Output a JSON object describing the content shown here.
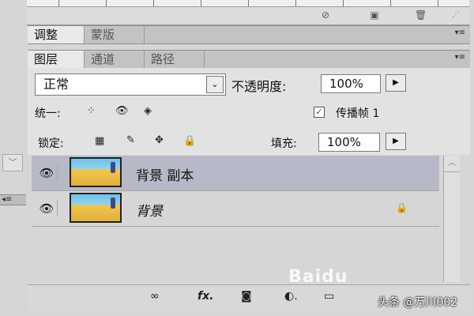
{
  "panels": {
    "adjust_group": {
      "tabs": [
        {
          "label": "调整",
          "active": true
        },
        {
          "label": "蒙版",
          "active": false
        }
      ]
    },
    "layers_group": {
      "tabs": [
        {
          "label": "图层",
          "active": true
        },
        {
          "label": "通道",
          "active": false
        },
        {
          "label": "路径",
          "active": false
        }
      ]
    }
  },
  "layers_panel": {
    "blend_mode": "正常",
    "opacity_label": "不透明度:",
    "opacity_value": "100%",
    "unify_label": "统一:",
    "propagate_label": "传播帧 1",
    "propagate_checked": true,
    "lock_label": "锁定:",
    "fill_label": "填充:",
    "fill_value": "100%",
    "layers": [
      {
        "name": "背景 副本",
        "visible": true,
        "selected": true,
        "locked": false
      },
      {
        "name": "背景",
        "visible": true,
        "selected": false,
        "locked": true
      }
    ]
  },
  "icons": {
    "eye": "eye-icon",
    "lock": "lock-icon",
    "link": "link-icon",
    "fx": "fx",
    "mask": "mask-icon",
    "adjustment": "adjustment-layer-icon",
    "new_layer": "new-layer-icon",
    "trash": "trash-icon"
  },
  "watermarks": {
    "baidu": "Baidu",
    "credit": "头条 @万川002"
  },
  "colors": {
    "panel_bg": "#d6d6d6",
    "selected_row": "#b7b9c8",
    "tab_bar": "#c3c3c3"
  }
}
